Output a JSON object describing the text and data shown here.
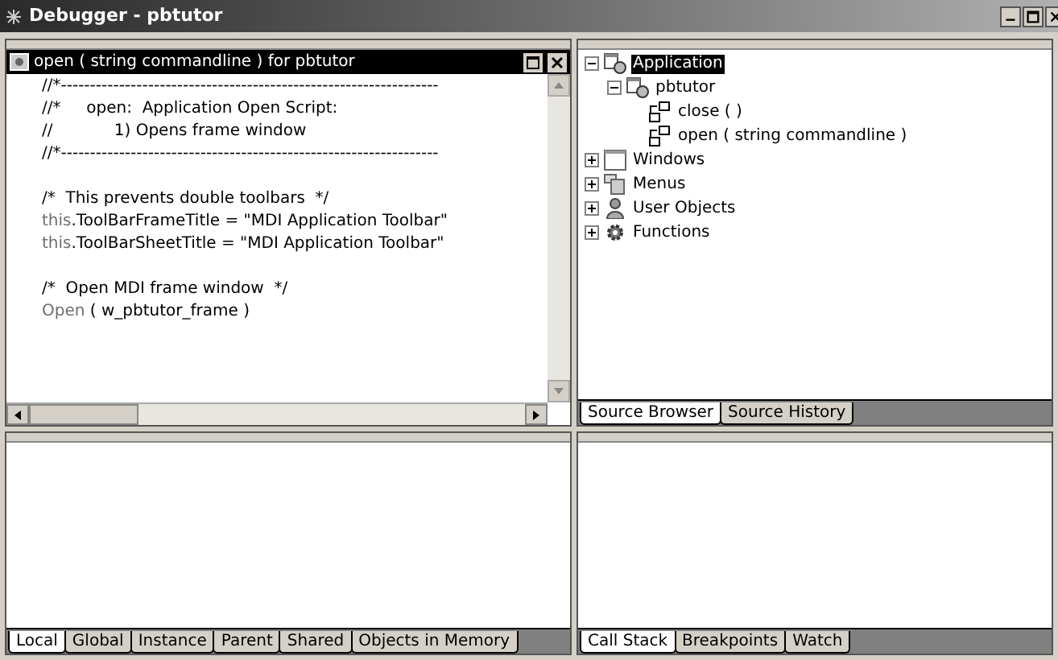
{
  "window": {
    "title": "Debugger - pbtutor"
  },
  "script_pane": {
    "title": "open ( string commandline ) for pbtutor",
    "lines": [
      {
        "kind": "code",
        "segments": [
          {
            "text": "//*-----------------------------------------------------------------",
            "kind": "plain"
          }
        ]
      },
      {
        "kind": "code",
        "segments": [
          {
            "text": "//*     open:  Application Open Script:",
            "kind": "plain"
          }
        ]
      },
      {
        "kind": "code",
        "segments": [
          {
            "text": "//            1) Opens frame window",
            "kind": "plain"
          }
        ]
      },
      {
        "kind": "code",
        "segments": [
          {
            "text": "//*-----------------------------------------------------------------",
            "kind": "plain"
          }
        ]
      },
      {
        "kind": "blank"
      },
      {
        "kind": "code",
        "segments": [
          {
            "text": "/*  This prevents double toolbars  */",
            "kind": "plain"
          }
        ]
      },
      {
        "kind": "code",
        "segments": [
          {
            "text": "this",
            "kind": "keyword"
          },
          {
            "text": ".ToolBarFrameTitle = \"MDI Application Toolbar\"",
            "kind": "plain"
          }
        ]
      },
      {
        "kind": "code",
        "segments": [
          {
            "text": "this",
            "kind": "keyword"
          },
          {
            "text": ".ToolBarSheetTitle = \"MDI Application Toolbar\"",
            "kind": "plain"
          }
        ]
      },
      {
        "kind": "blank"
      },
      {
        "kind": "code",
        "segments": [
          {
            "text": "/*  Open MDI frame window  */",
            "kind": "plain"
          }
        ]
      },
      {
        "kind": "code",
        "segments": [
          {
            "text": "Open",
            "kind": "keyword"
          },
          {
            "text": " ( w_pbtutor_frame )",
            "kind": "plain"
          }
        ]
      }
    ]
  },
  "tree": [
    {
      "label": "Application",
      "kind": "application",
      "expanded": true,
      "selected": true,
      "children": [
        {
          "label": "pbtutor",
          "kind": "application",
          "expanded": true,
          "selected": false,
          "children": [
            {
              "label": "close ( )",
              "kind": "event",
              "selected": false
            },
            {
              "label": "open ( string commandline )",
              "kind": "event",
              "selected": false
            }
          ]
        }
      ]
    },
    {
      "label": "Windows",
      "kind": "window",
      "expanded": false,
      "selected": false
    },
    {
      "label": "Menus",
      "kind": "menu",
      "expanded": false,
      "selected": false
    },
    {
      "label": "User Objects",
      "kind": "userobject",
      "expanded": false,
      "selected": false
    },
    {
      "label": "Functions",
      "kind": "function",
      "expanded": false,
      "selected": false
    }
  ],
  "browser_tabs": [
    {
      "label": "Source Browser",
      "selected": true
    },
    {
      "label": "Source History",
      "selected": false
    }
  ],
  "variable_tabs": [
    {
      "label": "Local",
      "selected": true
    },
    {
      "label": "Global",
      "selected": false
    },
    {
      "label": "Instance",
      "selected": false
    },
    {
      "label": "Parent",
      "selected": false
    },
    {
      "label": "Shared",
      "selected": false
    },
    {
      "label": "Objects in Memory",
      "selected": false
    }
  ],
  "stack_tabs": [
    {
      "label": "Call Stack",
      "selected": true
    },
    {
      "label": "Breakpoints",
      "selected": false
    },
    {
      "label": "Watch",
      "selected": false
    }
  ]
}
